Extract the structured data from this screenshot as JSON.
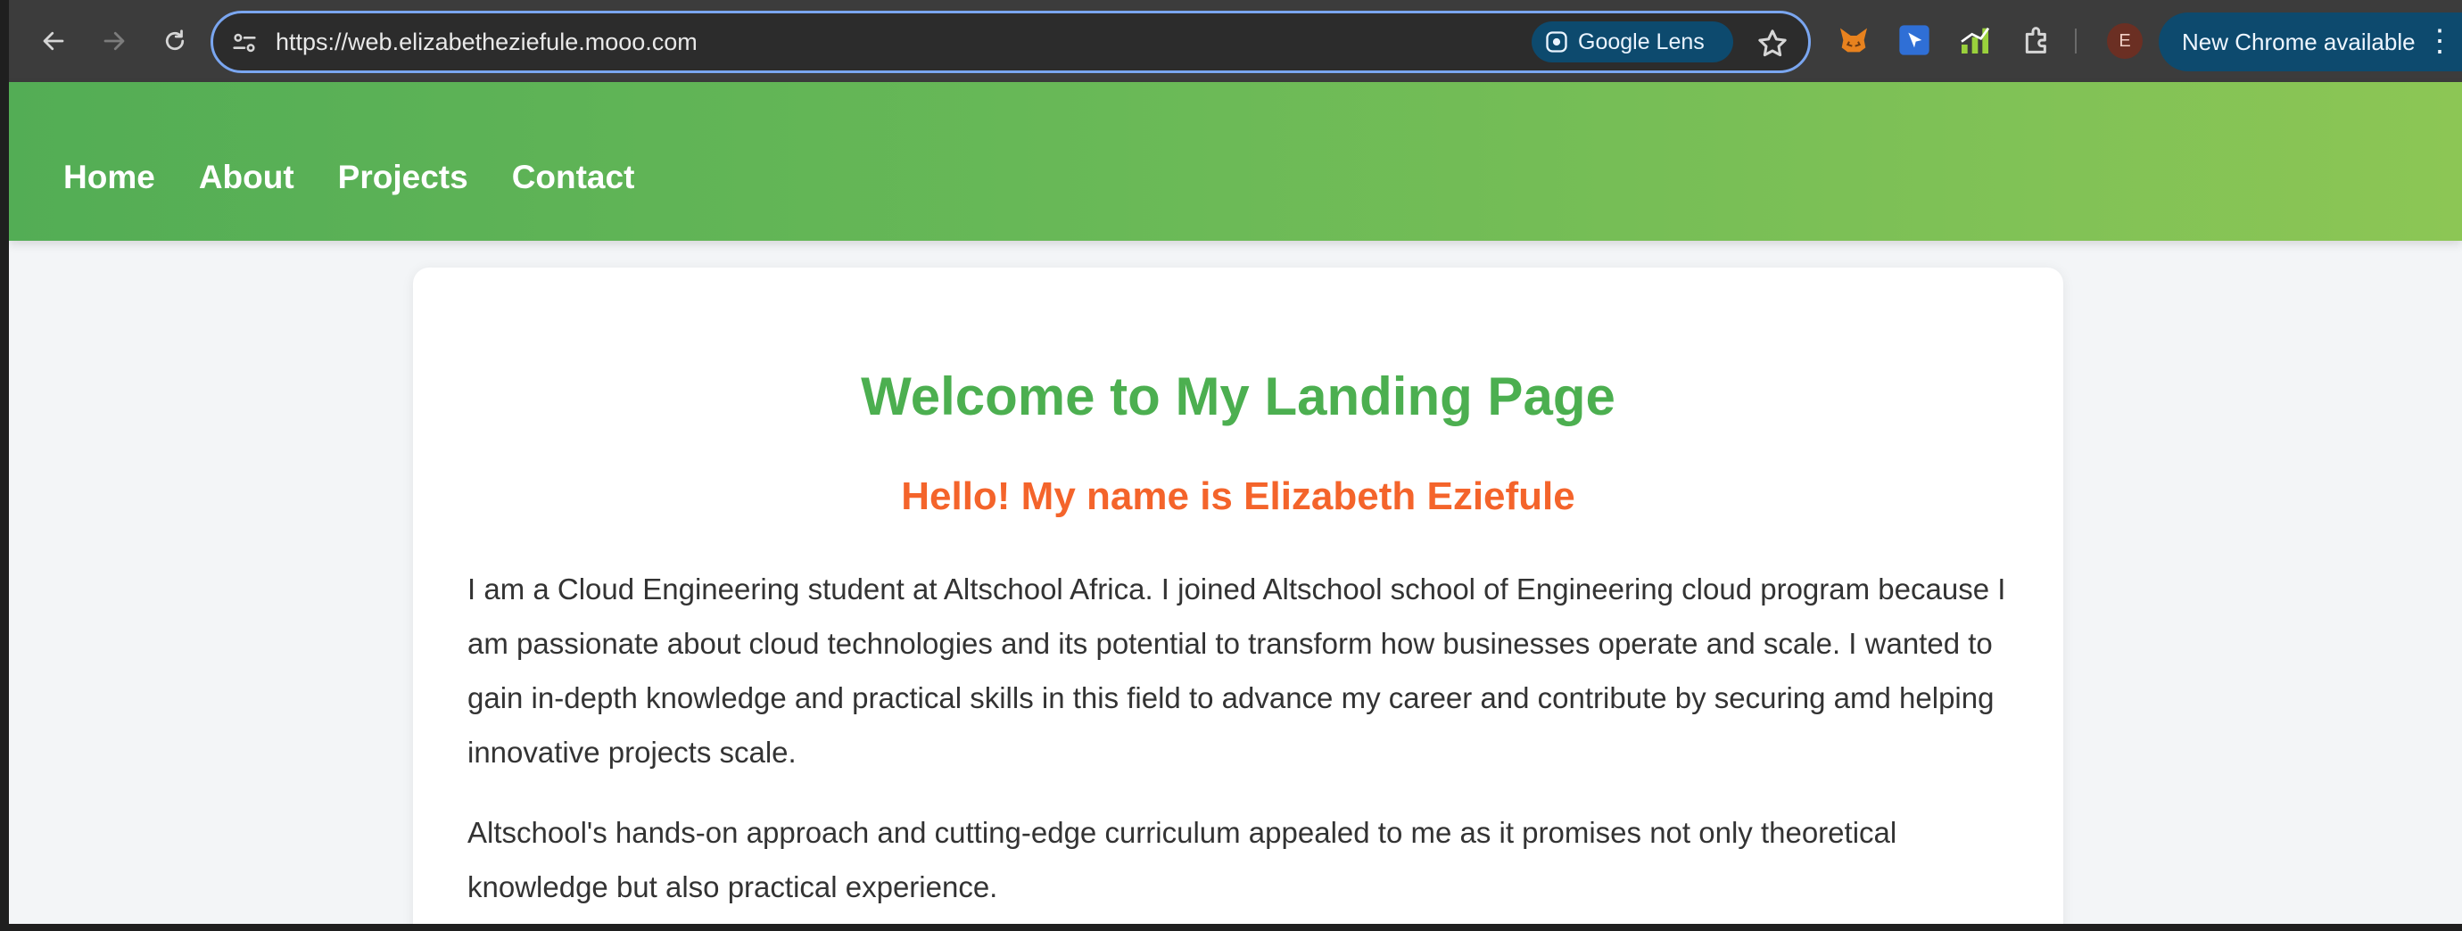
{
  "browser": {
    "url": "https://web.elizabetheziefule.mooo.com",
    "lens_label": "Google Lens",
    "avatar_letter": "E",
    "update_label": "New Chrome available",
    "menu_glyph": "⋮",
    "icons": [
      "back-arrow-icon",
      "forward-arrow-icon",
      "reload-icon",
      "site-info-icon",
      "google-lens-icon",
      "bookmark-star-icon",
      "metamask-fox-icon",
      "cursor-extension-icon",
      "signal-bars-extension-icon",
      "extensions-puzzle-icon",
      "chrome-menu-icon"
    ]
  },
  "site": {
    "nav": [
      "Home",
      "About",
      "Projects",
      "Contact"
    ],
    "title": "Welcome to My Landing Page",
    "subtitle": "Hello! My name is Elizabeth Eziefule",
    "paragraphs": [
      "I am a Cloud Engineering student at Altschool Africa. I joined Altschool school of Engineering cloud program because I am passionate about cloud technologies and its potential to transform how businesses operate and scale. I wanted to gain in-depth knowledge and practical skills in this field to advance my career and contribute by securing amd helping innovative projects scale.",
      "Altschool's hands-on approach and cutting-edge curriculum appealed to me as it promises not only theoretical knowledge but also practical experience."
    ]
  },
  "colors": {
    "header_gradient_start": "#53ad55",
    "header_gradient_end": "#8cc655",
    "title": "#4caf50",
    "subtitle": "#f4642b",
    "text": "#333333",
    "browser_chrome": "#3c3c3c",
    "accent_button": "#0d4a6e"
  }
}
